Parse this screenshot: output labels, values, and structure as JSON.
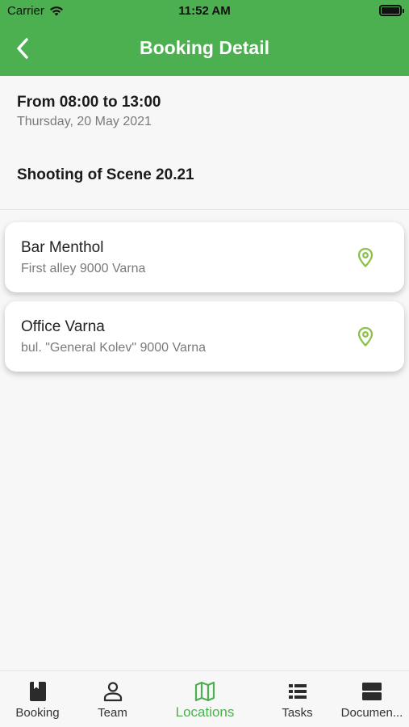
{
  "status_bar": {
    "carrier": "Carrier",
    "time": "11:52 AM"
  },
  "nav": {
    "title": "Booking Detail",
    "back_icon": "chevron-left-icon"
  },
  "booking": {
    "time_range": "From 08:00 to 13:00",
    "date": "Thursday, 20 May 2021",
    "title": "Shooting of Scene 20.21"
  },
  "locations": [
    {
      "name": "Bar Menthol",
      "address": "First alley 9000 Varna",
      "icon": "map-pin-icon"
    },
    {
      "name": "Office Varna",
      "address": "bul. \"General Kolev\" 9000 Varna",
      "icon": "map-pin-icon"
    }
  ],
  "tabs": [
    {
      "label": "Booking",
      "icon": "book-icon"
    },
    {
      "label": "Team",
      "icon": "person-icon"
    },
    {
      "label": "Locations",
      "icon": "map-icon",
      "active": true
    },
    {
      "label": "Tasks",
      "icon": "list-icon"
    },
    {
      "label": "Documen...",
      "icon": "documents-icon"
    }
  ],
  "colors": {
    "brand_green": "#4caf50",
    "pin_green": "#8bc34a",
    "background": "#f7f7f7"
  }
}
